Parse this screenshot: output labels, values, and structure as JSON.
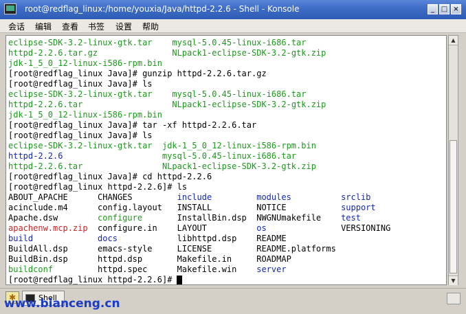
{
  "window": {
    "title": "root@redflag_linux:/home/youxia/Java/httpd-2.2.6 - Shell - Konsole",
    "min_glyph": "_",
    "max_glyph": "□",
    "close_glyph": "×"
  },
  "menu": [
    "会话",
    "编辑",
    "查看",
    "书签",
    "设置",
    "帮助"
  ],
  "terminal": {
    "lines": [
      [
        {
          "t": "eclipse-SDK-3.2-linux-gtk.tar    ",
          "c": "green"
        },
        {
          "t": "mysql-5.0.45-linux-i686.tar",
          "c": "green"
        }
      ],
      [
        {
          "t": "httpd-2.2.6.tar.gz               ",
          "c": "green"
        },
        {
          "t": "NLpack1-eclipse-SDK-3.2-gtk.zip",
          "c": "green"
        }
      ],
      [
        {
          "t": "jdk-1_5_0_12-linux-i586-rpm.bin",
          "c": "green"
        }
      ],
      [
        {
          "t": "[root@redflag_linux Java]# gunzip httpd-2.2.6.tar.gz",
          "c": "black"
        }
      ],
      [
        {
          "t": "[root@redflag_linux Java]# ls",
          "c": "black"
        }
      ],
      [
        {
          "t": "eclipse-SDK-3.2-linux-gtk.tar    ",
          "c": "green"
        },
        {
          "t": "mysql-5.0.45-linux-i686.tar",
          "c": "green"
        }
      ],
      [
        {
          "t": "httpd-2.2.6.tar                  ",
          "c": "green"
        },
        {
          "t": "NLpack1-eclipse-SDK-3.2-gtk.zip",
          "c": "green"
        }
      ],
      [
        {
          "t": "jdk-1_5_0_12-linux-i586-rpm.bin",
          "c": "green"
        }
      ],
      [
        {
          "t": "[root@redflag_linux Java]# tar -xf httpd-2.2.6.tar",
          "c": "black"
        }
      ],
      [
        {
          "t": "[root@redflag_linux Java]# ls",
          "c": "black"
        }
      ],
      [
        {
          "t": "eclipse-SDK-3.2-linux-gtk.tar  ",
          "c": "green"
        },
        {
          "t": "jdk-1_5_0_12-linux-i586-rpm.bin",
          "c": "green"
        }
      ],
      [
        {
          "t": "httpd-2.2.6                    ",
          "c": "blue"
        },
        {
          "t": "mysql-5.0.45-linux-i686.tar",
          "c": "green"
        }
      ],
      [
        {
          "t": "httpd-2.2.6.tar                ",
          "c": "green"
        },
        {
          "t": "NLpack1-eclipse-SDK-3.2-gtk.zip",
          "c": "green"
        }
      ],
      [
        {
          "t": "[root@redflag_linux Java]# cd httpd-2.2.6",
          "c": "black"
        }
      ],
      [
        {
          "t": "[root@redflag_linux httpd-2.2.6]# ls",
          "c": "black"
        }
      ],
      [
        {
          "t": "ABOUT_APACHE      CHANGES         ",
          "c": "black"
        },
        {
          "t": "include         ",
          "c": "blue"
        },
        {
          "t": "modules          ",
          "c": "blue"
        },
        {
          "t": "srclib",
          "c": "blue"
        }
      ],
      [
        {
          "t": "acinclude.m4      config.layout   INSTALL         NOTICE           ",
          "c": "black"
        },
        {
          "t": "support",
          "c": "blue"
        }
      ],
      [
        {
          "t": "Apache.dsw        ",
          "c": "black"
        },
        {
          "t": "configure       ",
          "c": "green"
        },
        {
          "t": "InstallBin.dsp  NWGNUmakefile    ",
          "c": "black"
        },
        {
          "t": "test",
          "c": "blue"
        }
      ],
      [
        {
          "t": "apachenw.mcp.zip  ",
          "c": "red"
        },
        {
          "t": "configure.in    LAYOUT          ",
          "c": "black"
        },
        {
          "t": "os               ",
          "c": "blue"
        },
        {
          "t": "VERSIONING",
          "c": "black"
        }
      ],
      [
        {
          "t": "build             ",
          "c": "blue"
        },
        {
          "t": "docs            ",
          "c": "blue"
        },
        {
          "t": "libhttpd.dsp    README",
          "c": "black"
        }
      ],
      [
        {
          "t": "BuildAll.dsp      emacs-style     LICENSE         README.platforms",
          "c": "black"
        }
      ],
      [
        {
          "t": "BuildBin.dsp      httpd.dsp       Makefile.in     ROADMAP",
          "c": "black"
        }
      ],
      [
        {
          "t": "buildconf         ",
          "c": "green"
        },
        {
          "t": "httpd.spec      Makefile.win    ",
          "c": "black"
        },
        {
          "t": "server",
          "c": "blue"
        }
      ],
      [
        {
          "t": "[root@redflag_linux httpd-2.2.6]# ",
          "c": "black"
        }
      ]
    ]
  },
  "scrollbar": {
    "up_glyph": "▲",
    "down_glyph": "▼"
  },
  "tabs": [
    {
      "label": "Shell"
    }
  ],
  "watermark": "www.bianceng.cn",
  "colors": {
    "black": "#000000",
    "green": "#1a9a1a",
    "blue": "#1428b4",
    "red": "#d02020"
  }
}
